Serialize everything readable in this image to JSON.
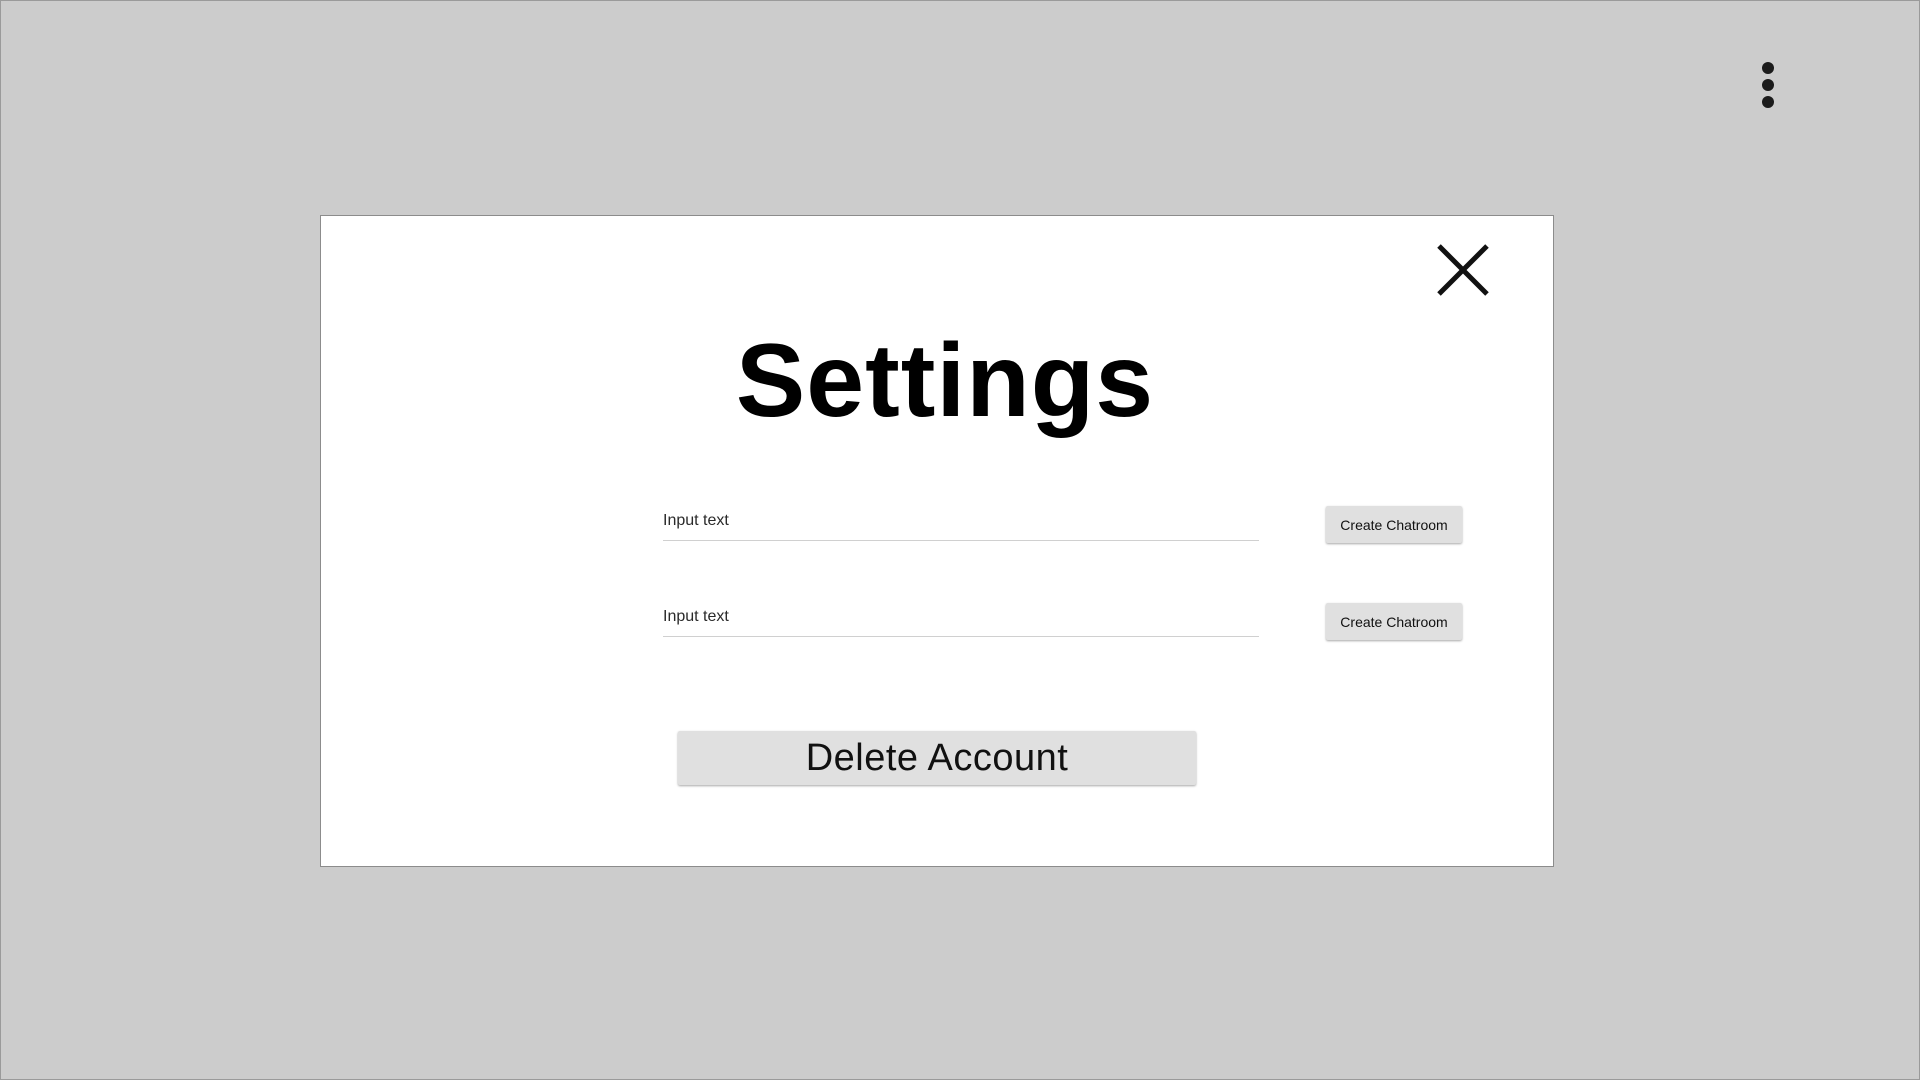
{
  "menu": {
    "icon": "more-vert-icon"
  },
  "dialog": {
    "title": "Settings",
    "close_icon": "close-icon",
    "rows": [
      {
        "placeholder": "Input text",
        "value": "",
        "button_label": "Create Chatroom"
      },
      {
        "placeholder": "Input text",
        "value": "",
        "button_label": "Create Chatroom"
      }
    ],
    "delete_label": "Delete Account"
  },
  "colors": {
    "background": "#cccccc",
    "dialog": "#ffffff",
    "button": "#e0e0e0",
    "text": "#111111"
  }
}
